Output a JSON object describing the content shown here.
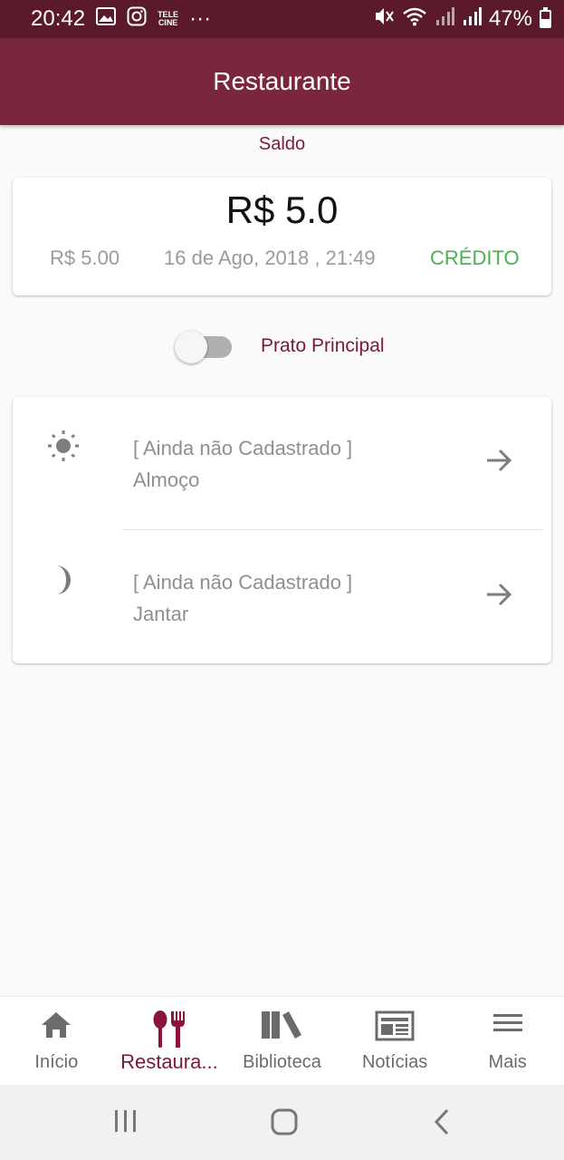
{
  "status_bar": {
    "time": "20:42",
    "tele_line1": "TELE",
    "tele_line2": "CINE",
    "more": "···",
    "battery": "47%",
    "battery_level": 0.47
  },
  "app_bar": {
    "title": "Restaurante"
  },
  "balance": {
    "label": "Saldo",
    "amount": "R$ 5.0",
    "transaction": {
      "amount": "R$ 5.00",
      "date": "16 de Ago, 2018 , 21:49",
      "type": "CRÉDITO"
    }
  },
  "toggle": {
    "label": "Prato Principal",
    "on": false
  },
  "meals": [
    {
      "status": "[ Ainda não Cadastrado ]",
      "name": "Almoço",
      "icon": "sun-icon"
    },
    {
      "status": "[ Ainda não Cadastrado ]",
      "name": "Jantar",
      "icon": "moon-icon"
    }
  ],
  "bottom_nav": [
    {
      "label": "Início",
      "icon": "home-icon",
      "active": false
    },
    {
      "label": "Restaura...",
      "icon": "restaurant-icon",
      "active": true
    },
    {
      "label": "Biblioteca",
      "icon": "books-icon",
      "active": false
    },
    {
      "label": "Notícias",
      "icon": "newspaper-icon",
      "active": false
    },
    {
      "label": "Mais",
      "icon": "menu-icon",
      "active": false
    }
  ],
  "colors": {
    "primary": "#7a263e",
    "status_bar": "#5a1a2c",
    "accent_text": "#7a1a35",
    "credit": "#4caf50"
  }
}
